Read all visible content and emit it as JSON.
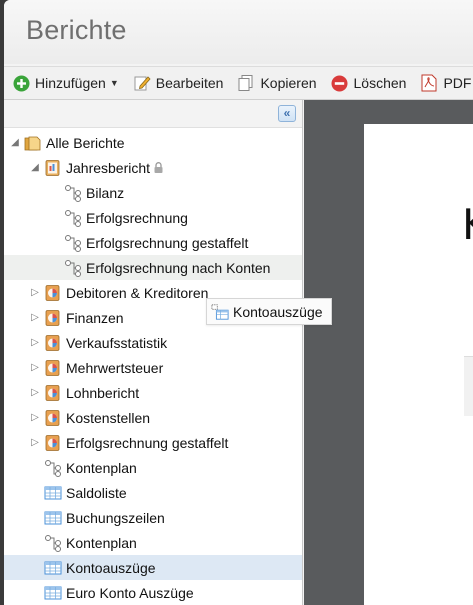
{
  "window": {
    "title": "Berichte"
  },
  "toolbar": {
    "add_label": "Hinzufügen",
    "edit_label": "Bearbeiten",
    "copy_label": "Kopieren",
    "delete_label": "Löschen",
    "pdf_label": "PDF"
  },
  "sidebar": {
    "collapse_glyph": "«"
  },
  "tree": {
    "root": "Alle Berichte",
    "jahresbericht": "Jahresbericht",
    "bilanz": "Bilanz",
    "erfolgsrechnung": "Erfolgsrechnung",
    "erfolgsrechnung_gestaffelt": "Erfolgsrechnung gestaffelt",
    "erfolgsrechnung_nach_konten": "Erfolgsrechnung nach Konten",
    "debitoren": "Debitoren & Kreditoren",
    "finanzen": "Finanzen",
    "verkaufsstatistik": "Verkaufsstatistik",
    "mehrwertsteuer": "Mehrwertsteuer",
    "lohnbericht": "Lohnbericht",
    "kostenstellen": "Kostenstellen",
    "erfolgsrechnung_gestaffelt_2": "Erfolgsrechnung gestaffelt",
    "kontenplan_1": "Kontenplan",
    "saldoliste": "Saldoliste",
    "buchungszeilen": "Buchungszeilen",
    "kontenplan_2": "Kontenplan",
    "kontoauszuege": "Kontoauszüge",
    "euro_konto": "Euro Konto Auszüge"
  },
  "drag": {
    "label": "Kontoauszüge"
  },
  "preview": {
    "letter": "K"
  }
}
